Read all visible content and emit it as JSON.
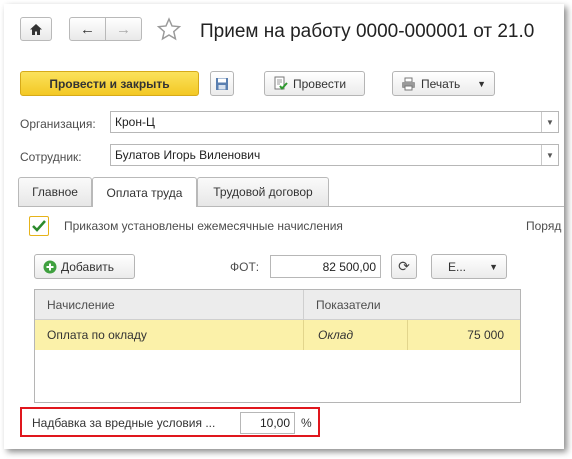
{
  "window": {
    "title": "Прием на работу 0000-000001 от 21.0"
  },
  "toolbar": {
    "post_close_label": "Провести и закрыть",
    "post_label": "Провести",
    "print_label": "Печать"
  },
  "form": {
    "organization": {
      "label": "Организация:",
      "value": "Крон-Ц"
    },
    "employee": {
      "label": "Сотрудник:",
      "value": "Булатов Игорь Виленович"
    }
  },
  "tabs": [
    {
      "label": "Главное",
      "active": false
    },
    {
      "label": "Оплата труда",
      "active": true
    },
    {
      "label": "Трудовой договор",
      "active": false
    }
  ],
  "payment": {
    "checkbox_label": "Приказом установлены ежемесячные начисления",
    "checkbox_checked": true,
    "right_cut_label": "Поряд",
    "add_label": "Добавить",
    "fot_label": "ФОТ:",
    "fot_value": "82 500,00",
    "e_label": "Е...",
    "grid": {
      "headers": [
        "Начисление",
        "Показатели"
      ],
      "rows": [
        {
          "accrual": "Оплата по окладу",
          "indicator": "Оклад",
          "value": "75 000"
        }
      ]
    },
    "bonus": {
      "label": "Надбавка за вредные условия ...",
      "value": "10,00",
      "unit": "%"
    }
  },
  "colors": {
    "primary_button": "#f5cc2a",
    "selected_row": "#fbf1a9",
    "highlight_border": "#e0161d"
  }
}
